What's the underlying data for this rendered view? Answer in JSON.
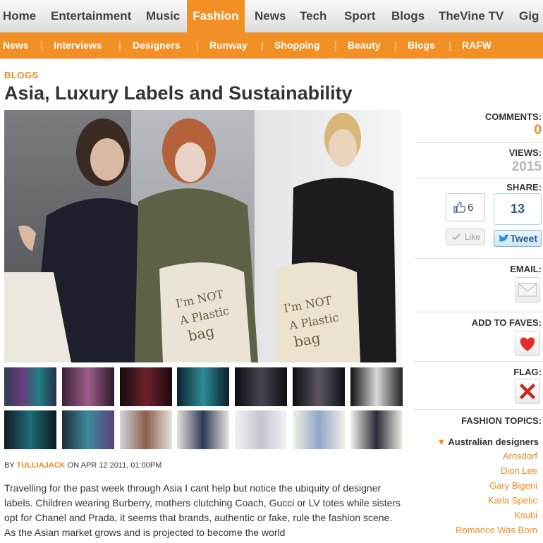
{
  "topnav": {
    "items": [
      "Home",
      "Entertainment",
      "Music",
      "Fashion",
      "News",
      "Tech",
      "Sport",
      "Blogs",
      "TheVine TV",
      "Gig"
    ],
    "active": "Fashion"
  },
  "subnav": {
    "items": [
      "News",
      "Interviews",
      "Designers",
      "Runway",
      "Shopping",
      "Beauty",
      "Blogs",
      "RAFW"
    ],
    "separator": "|"
  },
  "article": {
    "section": "BLOGS",
    "title": "Asia, Luxury Labels and Sustainability",
    "byline_prefix": "BY",
    "author": "TULLIAJACK",
    "date": "ON APR 12 2011, 01:00PM",
    "body": "Travelling for the past week through Asia I cant help but notice the ubiquity of designer labels.  Children wearing Burberry, mothers clutching Coach, Gucci or LV totes while sisters opt for Chanel and Prada, it seems that brands, authentic or fake, rule the fashion scene.  As the Asian market grows and is projected to become the world"
  },
  "hero": {
    "bag_text_1": "I'm NOT A Plastic bag",
    "bag_text_2": "I'm NOT A Plastic bag"
  },
  "sidebar": {
    "comments_label": "COMMENTS:",
    "comments_value": "0",
    "views_label": "VIEWS:",
    "views_value": "2015",
    "share_label": "SHARE:",
    "fb_count": "6",
    "fb_like_label": "Like",
    "tweet_count": "13",
    "tweet_label": "Tweet",
    "email_label": "EMAIL:",
    "faves_label": "ADD TO FAVES:",
    "flag_label": "FLAG:",
    "topics_label": "FASHION TOPICS:",
    "topics_heading": "Australian designers",
    "topics": [
      "Arnsdorf",
      "Dion Lee",
      "Gary Bigeni",
      "Karla Spetic",
      "Ksubi",
      "Romance Was Born"
    ]
  },
  "colors": {
    "accent": "#f39025",
    "link": "#f08a1c",
    "views": "#b8b8b8"
  }
}
